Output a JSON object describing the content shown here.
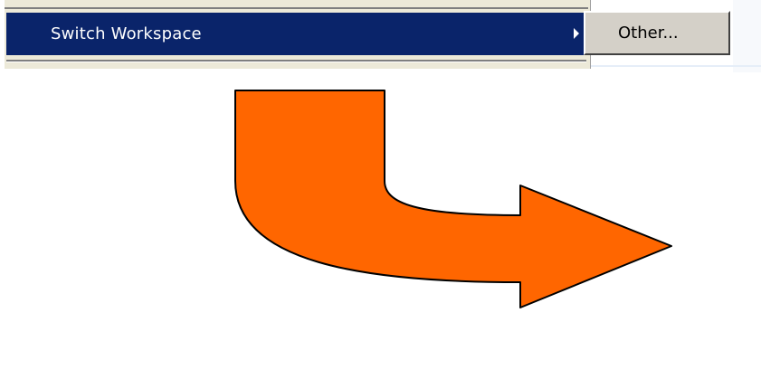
{
  "menu": {
    "item_label": "Switch Workspace",
    "highlight_color": "#0a246a"
  },
  "submenu": {
    "item_label": "Other..."
  },
  "arrow": {
    "icon": "curved-arrow-right-icon",
    "fill": "#ff6600",
    "stroke": "#000000"
  }
}
